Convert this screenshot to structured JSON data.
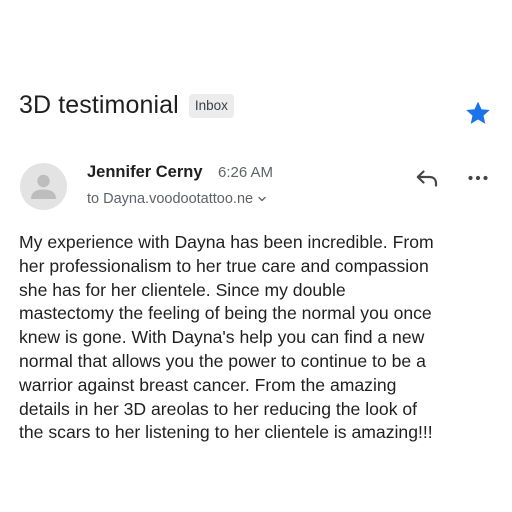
{
  "email": {
    "subject": "3D testimonial",
    "label": "Inbox",
    "starred": true,
    "sender_name": "Jennifer Cerny",
    "time": "6:26 AM",
    "recipient": "to Dayna.voodootattoo.ne",
    "body": "My experience with Dayna has been incredible. From\nher professionalism to her true care and compassion\nshe has for her clientele. Since my double\nmastectomy the feeling of being the normal you once\nknew is gone. With Dayna's help you can find a new\nnormal that allows you the power to continue to be a\nwarrior against breast cancer. From the amazing\ndetails in her 3D areolas to her reducing the look of\nthe scars to her listening to her clientele is amazing!!!"
  },
  "icons": {
    "star": "star-icon",
    "avatar": "person-icon",
    "reply": "reply-icon",
    "more": "more-horizontal-icon",
    "expand": "chevron-down-icon"
  },
  "colors": {
    "star": "#1a73e8",
    "avatar_bg": "#e3e3e3",
    "avatar_fg": "#bdbdbd",
    "label_bg": "#ececec",
    "secondary_text": "#5f6368",
    "icon": "#444746"
  }
}
